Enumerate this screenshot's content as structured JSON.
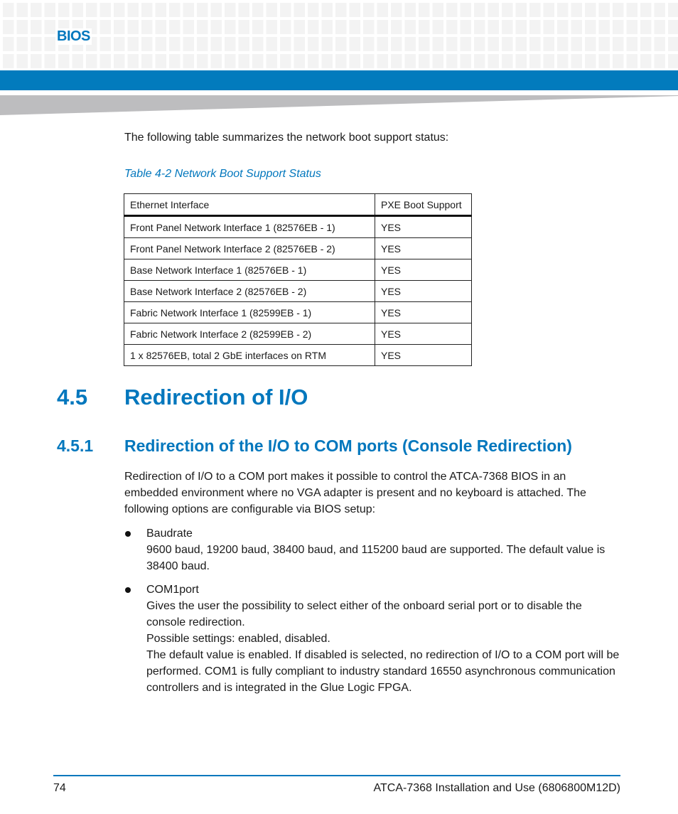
{
  "header": {
    "section_label": "BIOS",
    "accent_color": "#0277bd"
  },
  "intro_text": "The following table summarizes the network boot support status:",
  "table": {
    "caption": "Table 4-2 Network Boot Support Status",
    "columns": [
      "Ethernet Interface",
      "PXE Boot Support"
    ],
    "rows": [
      [
        "Front Panel Network Interface 1 (82576EB - 1)",
        "YES"
      ],
      [
        "Front Panel Network Interface 2 (82576EB - 2)",
        "YES"
      ],
      [
        "Base Network Interface 1 (82576EB - 1)",
        "YES"
      ],
      [
        "Base Network Interface 2 (82576EB - 2)",
        "YES"
      ],
      [
        "Fabric Network Interface 1 (82599EB - 1)",
        "YES"
      ],
      [
        "Fabric Network Interface 2 (82599EB - 2)",
        "YES"
      ],
      [
        "1 x 82576EB, total 2 GbE interfaces on RTM",
        "YES"
      ]
    ]
  },
  "section": {
    "number": "4.5",
    "title": "Redirection of I/O"
  },
  "subsection": {
    "number": "4.5.1",
    "title": "Redirection of the I/O to COM ports (Console Redirection)",
    "paragraph": "Redirection of I/O to a COM port makes it possible to control the ATCA-7368 BIOS in an embedded environment where no VGA adapter is present and no keyboard is attached. The following options are configurable via BIOS setup:",
    "bullets": [
      {
        "title": "Baudrate",
        "lines": [
          "9600 baud, 19200 baud, 38400 baud, and 115200 baud are supported. The default value is 38400 baud."
        ]
      },
      {
        "title": "COM1port",
        "lines": [
          "Gives the user the possibility to select either of the onboard serial port or to disable the console redirection.",
          "Possible settings: enabled, disabled.",
          "The default value is enabled. If disabled is selected, no redirection of I/O to a COM port will be performed. COM1 is fully compliant to industry standard 16550 asynchronous communication controllers and is integrated in the Glue Logic FPGA."
        ]
      }
    ]
  },
  "footer": {
    "page_number": "74",
    "doc_title": "ATCA-7368 Installation and Use (6806800M12D)"
  }
}
